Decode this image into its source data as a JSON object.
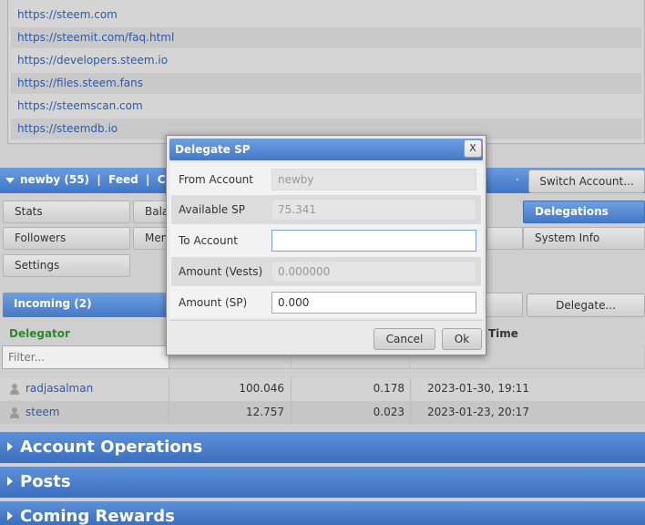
{
  "links": [
    "https://steem.com",
    "https://steemit.com/faq.html",
    "https://developers.steem.io",
    "https://files.steem.fans",
    "https://steemscan.com",
    "https://steemdb.io"
  ],
  "account_bar": {
    "label": "newby (55)  |  Feed  |  Comm",
    "separator": "·",
    "switch_account": "Switch Account..."
  },
  "tabs": {
    "stats": "Stats",
    "balances": "Bala",
    "delegations": "Delegations",
    "followers": "Followers",
    "menu2": "Men",
    "system_info": "System Info",
    "settings": "Settings"
  },
  "subtabs": {
    "incoming": "Incoming (2)",
    "delegate_button": "Delegate..."
  },
  "table": {
    "col_delegator": "Delegator",
    "col_time": "Time",
    "filter_placeholder": "Filter...",
    "rows": [
      {
        "name": "radjasalman",
        "sp": "100.046",
        "vests": "0.178",
        "time": "2023-01-30, 19:11"
      },
      {
        "name": "steem",
        "sp": "12.757",
        "vests": "0.023",
        "time": "2023-01-23, 20:17"
      }
    ]
  },
  "sections": [
    "Account Operations",
    "Posts",
    "Coming Rewards"
  ],
  "dialog": {
    "title": "Delegate SP",
    "close": "X",
    "fields": {
      "from_account_label": "From Account",
      "from_account_value": "newby",
      "available_sp_label": "Available SP",
      "available_sp_value": "75.341",
      "to_account_label": "To Account",
      "to_account_value": "",
      "amount_vests_label": "Amount (Vests)",
      "amount_vests_value": "0.000000",
      "amount_sp_label": "Amount (SP)",
      "amount_sp_value": "0.000"
    },
    "cancel": "Cancel",
    "ok": "Ok"
  },
  "colors": {
    "accent_blue": "#4479c6",
    "link": "#2b5aa8",
    "delegator_header": "#2a8a2a"
  }
}
